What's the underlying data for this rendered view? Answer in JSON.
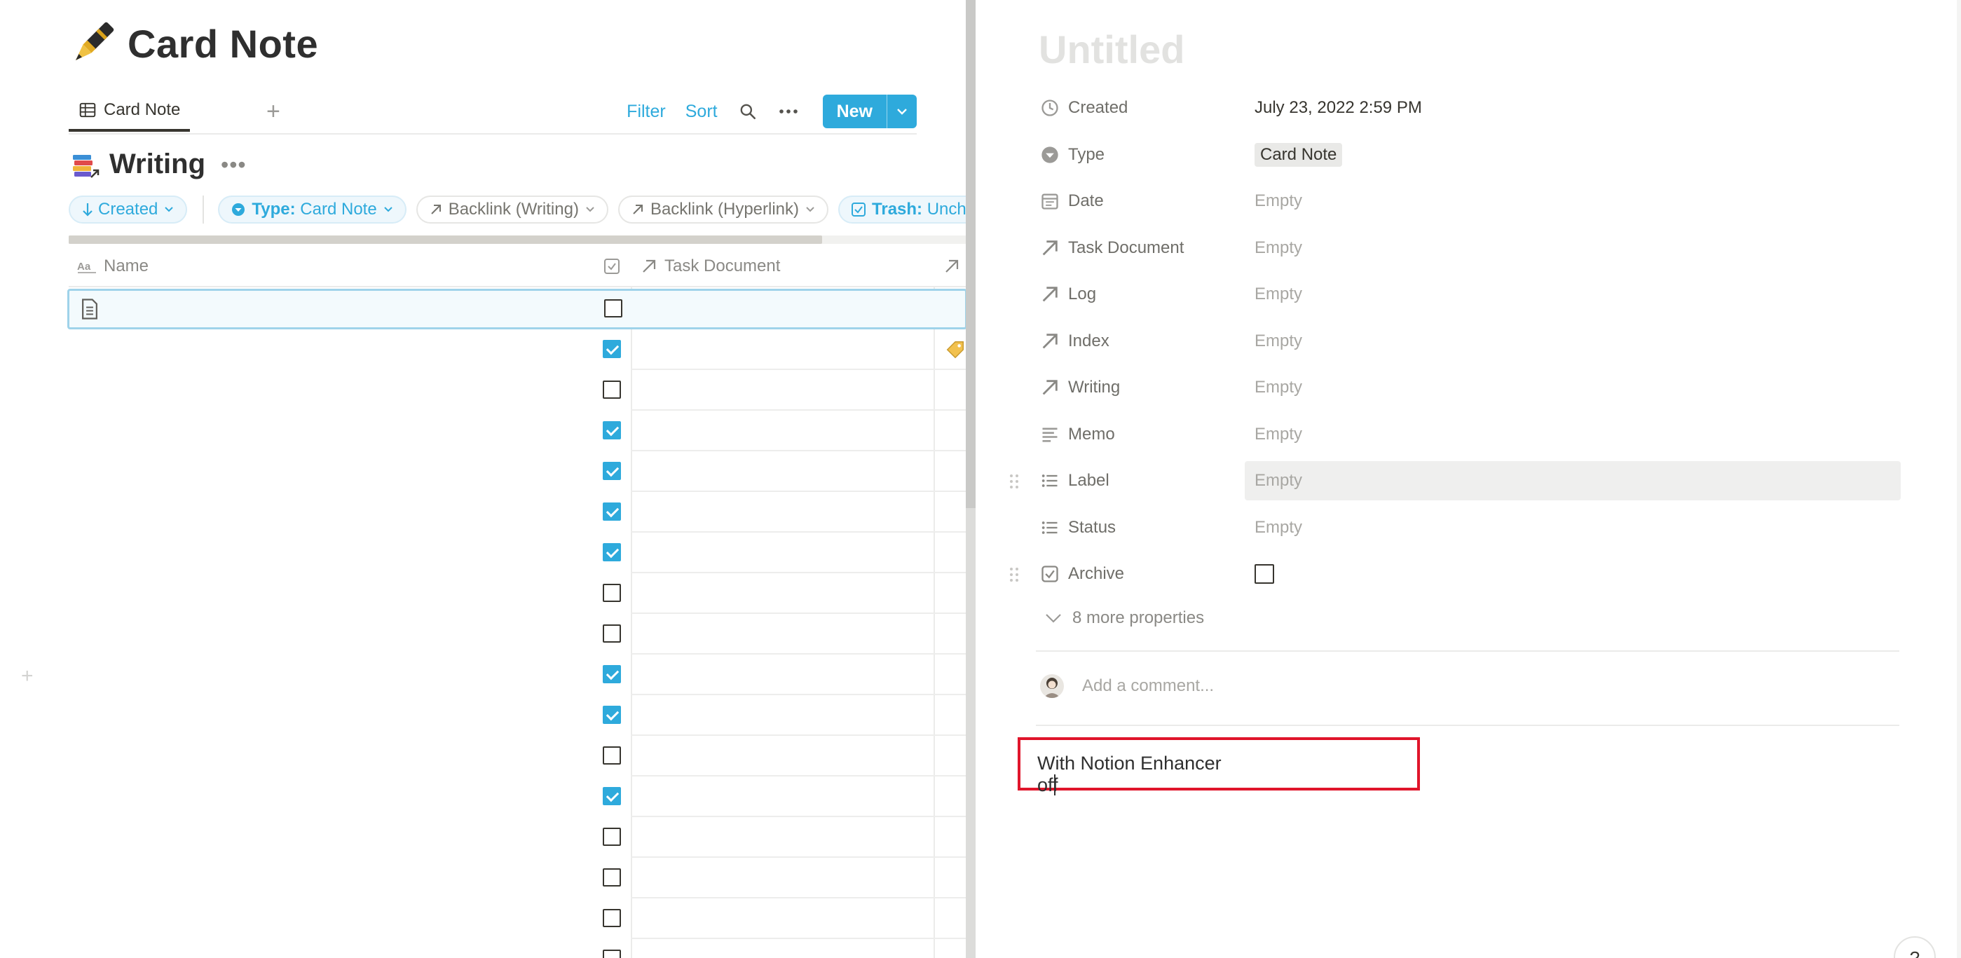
{
  "page": {
    "title": "Card Note"
  },
  "view_tab": {
    "label": "Card Note"
  },
  "toolbar": {
    "filter": "Filter",
    "sort": "Sort",
    "new_label": "New"
  },
  "database": {
    "title": "Writing"
  },
  "filters": [
    {
      "prefix": "",
      "value": "Created",
      "style": "active"
    },
    {
      "prefix": "Type:",
      "value": "Card Note",
      "style": "active"
    },
    {
      "prefix": "",
      "value": "Backlink (Writing)",
      "style": "gray"
    },
    {
      "prefix": "",
      "value": "Backlink (Hyperlink)",
      "style": "gray"
    },
    {
      "prefix": "Trash:",
      "value": "Unchec",
      "style": "active"
    }
  ],
  "table": {
    "columns": [
      "Name",
      "",
      "Task Document"
    ],
    "rows_checked": [
      false,
      true,
      false,
      true,
      true,
      true,
      true,
      false,
      false,
      true,
      true,
      false,
      true,
      false,
      false,
      false,
      false
    ]
  },
  "peek": {
    "title": "Untitled",
    "properties": [
      {
        "name": "Created",
        "value": "July 23, 2022 2:59 PM",
        "icon": "clock-icon",
        "empty": false
      },
      {
        "name": "Type",
        "value": "Card Note",
        "icon": "select-icon",
        "empty": false,
        "tag": true
      },
      {
        "name": "Date",
        "value": "Empty",
        "icon": "calendar-icon",
        "empty": true
      },
      {
        "name": "Task Document",
        "value": "Empty",
        "icon": "relation-arrow-icon",
        "empty": true
      },
      {
        "name": "Log",
        "value": "Empty",
        "icon": "relation-arrow-icon",
        "empty": true
      },
      {
        "name": "Index",
        "value": "Empty",
        "icon": "relation-arrow-icon",
        "empty": true
      },
      {
        "name": "Writing",
        "value": "Empty",
        "icon": "relation-arrow-icon",
        "empty": true
      },
      {
        "name": "Memo",
        "value": "Empty",
        "icon": "text-icon",
        "empty": true
      },
      {
        "name": "Label",
        "value": "Empty",
        "icon": "multi-select-icon",
        "empty": true,
        "hover": true
      },
      {
        "name": "Status",
        "value": "Empty",
        "icon": "multi-select-icon",
        "empty": true
      },
      {
        "name": "Archive",
        "value": "",
        "icon": "checkbox-icon",
        "empty": false,
        "checkbox": true
      }
    ],
    "more_properties": "8 more properties",
    "comment_placeholder": "Add a comment...",
    "body_text": "With Notion Enhancer off",
    "help": "?"
  }
}
